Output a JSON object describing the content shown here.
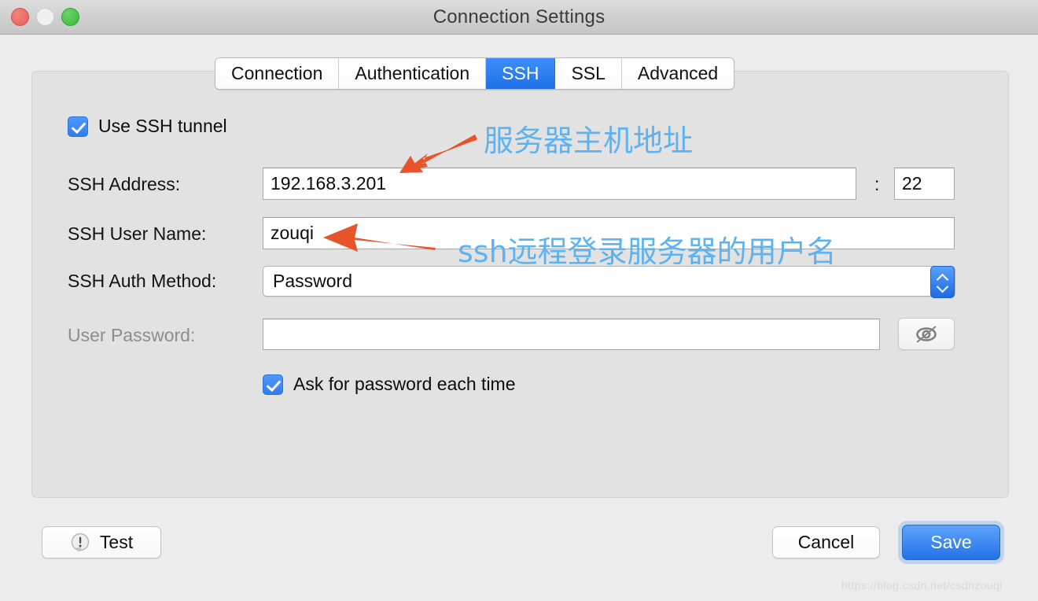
{
  "window": {
    "title": "Connection Settings",
    "traffic_lights": [
      "close",
      "minimize",
      "zoom"
    ]
  },
  "tabs": [
    {
      "label": "Connection",
      "active": false
    },
    {
      "label": "Authentication",
      "active": false
    },
    {
      "label": "SSH",
      "active": true
    },
    {
      "label": "SSL",
      "active": false
    },
    {
      "label": "Advanced",
      "active": false
    }
  ],
  "form": {
    "use_tunnel_label": "Use SSH tunnel",
    "use_tunnel_checked": "checked",
    "address_label": "SSH Address:",
    "address_value": "192.168.3.201",
    "port_separator": ":",
    "port_value": "22",
    "username_label": "SSH User Name:",
    "username_value": "zouqi",
    "auth_method_label": "SSH Auth Method:",
    "auth_method_value": "Password",
    "password_label": "User Password:",
    "password_value": "",
    "ask_each_time_label": "Ask for password each time",
    "ask_each_time_checked": "checked"
  },
  "buttons": {
    "test_label": "Test",
    "cancel_label": "Cancel",
    "save_label": "Save"
  },
  "annotations": {
    "host_note": "服务器主机地址",
    "user_note": "ssh远程登录服务器的用户名",
    "arrow_color": "#e8542a",
    "note_color": "#5cb3f0"
  },
  "watermark": "https://blog.csdn.net/csdnzouqi",
  "colors": {
    "accent_blue": "#2272e8",
    "tab_active": "#2f7ef0",
    "window_bg": "#ececec",
    "panel_bg": "#e2e2e2"
  }
}
